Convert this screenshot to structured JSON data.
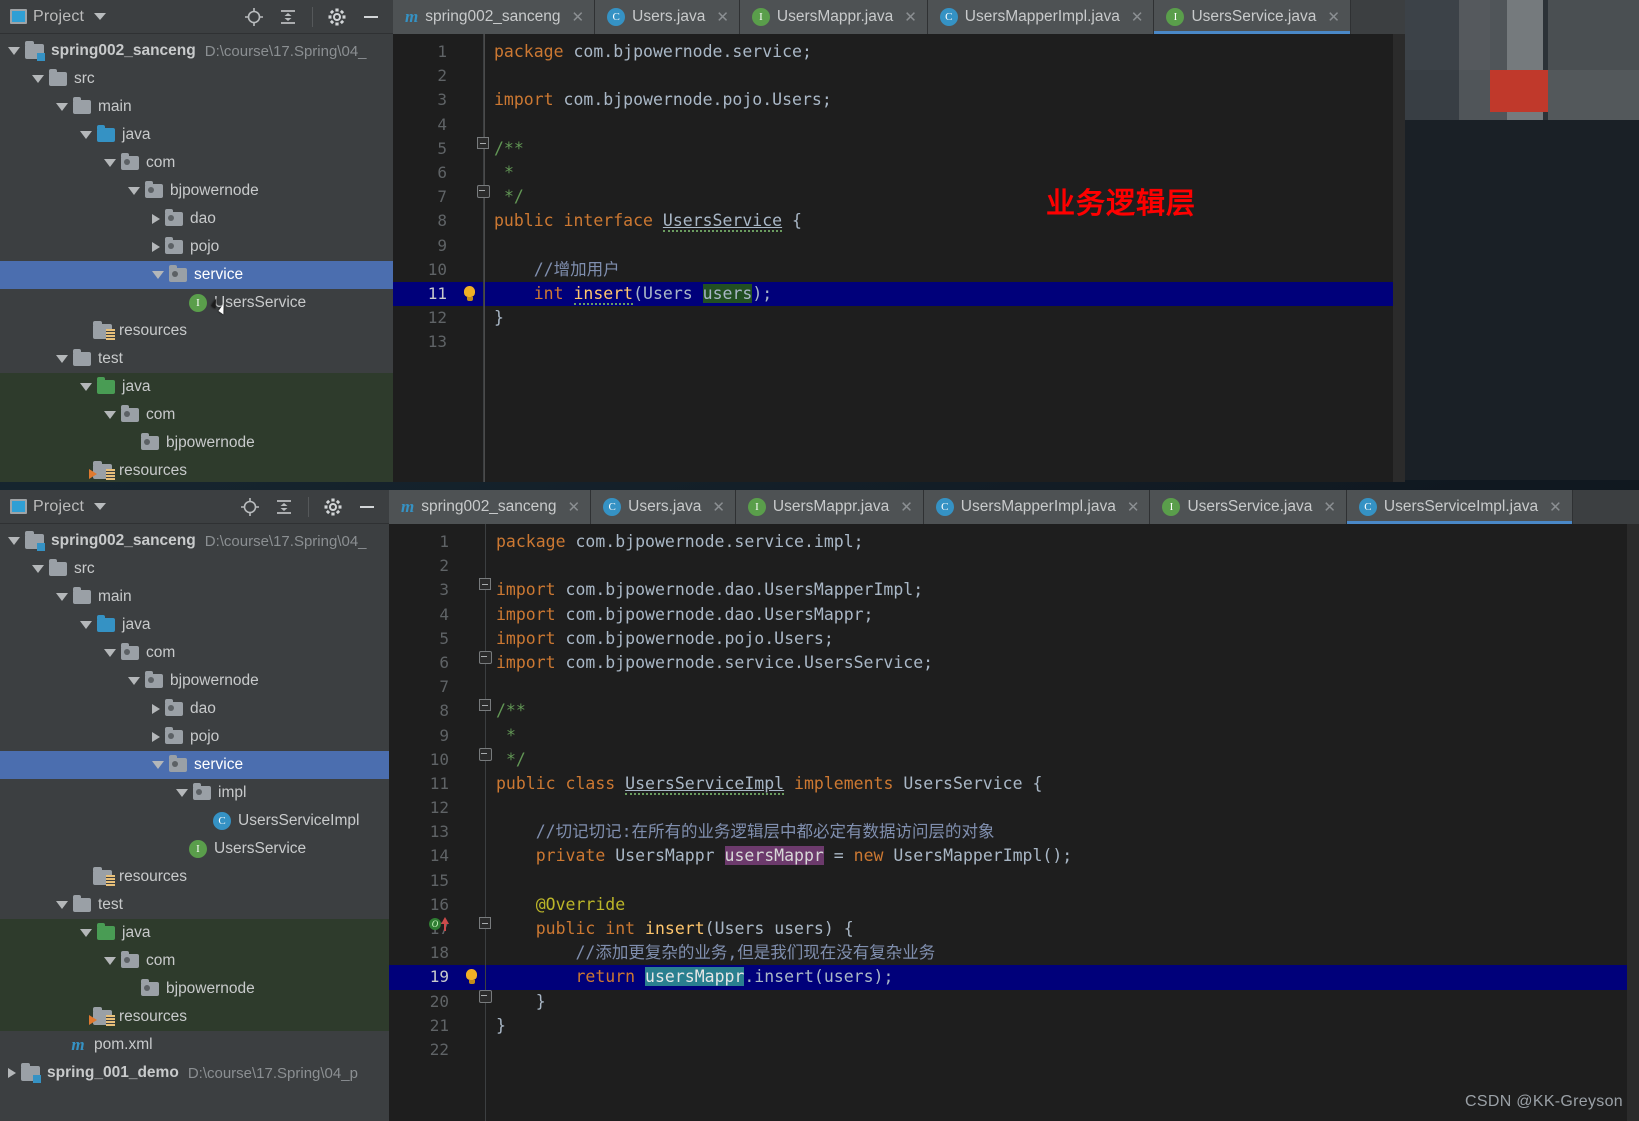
{
  "desktop": {
    "watermark": "CSDN @KK-Greyson"
  },
  "top_window": {
    "panel": {
      "title": "Project",
      "icons": [
        "locate-icon",
        "collapse-all-icon",
        "settings-gear-icon",
        "minimize-icon"
      ]
    },
    "tree": [
      {
        "label": "spring002_sanceng",
        "path": "D:\\course\\17.Spring\\04_",
        "icon": "module-icon",
        "arrow": "down",
        "depth": 0,
        "bold": true
      },
      {
        "label": "src",
        "icon": "folder-icon",
        "arrow": "down",
        "depth": 1
      },
      {
        "label": "main",
        "icon": "folder-icon",
        "arrow": "down",
        "depth": 2
      },
      {
        "label": "java",
        "icon": "folder-source-icon",
        "arrow": "down",
        "depth": 3
      },
      {
        "label": "com",
        "icon": "package-icon",
        "arrow": "down",
        "depth": 4
      },
      {
        "label": "bjpowernode",
        "icon": "package-icon",
        "arrow": "down",
        "depth": 5
      },
      {
        "label": "dao",
        "icon": "package-icon",
        "arrow": "right",
        "depth": 6
      },
      {
        "label": "pojo",
        "icon": "package-icon",
        "arrow": "right",
        "depth": 6
      },
      {
        "label": "service",
        "icon": "package-icon",
        "arrow": "down",
        "depth": 6,
        "selected": true
      },
      {
        "label": "UsersService",
        "icon": "interface-icon",
        "arrow": "none",
        "depth": 7
      },
      {
        "label": "resources",
        "icon": "resources-icon",
        "arrow": "none",
        "depth": 3
      },
      {
        "label": "test",
        "icon": "folder-icon",
        "arrow": "down",
        "depth": 2
      },
      {
        "label": "java",
        "icon": "folder-test-icon",
        "arrow": "down",
        "depth": 3,
        "test": true
      },
      {
        "label": "com",
        "icon": "package-icon",
        "arrow": "down",
        "depth": 4,
        "test": true
      },
      {
        "label": "bjpowernode",
        "icon": "package-icon",
        "arrow": "none",
        "depth": 5,
        "test": true
      },
      {
        "label": "resources",
        "icon": "resources-test-icon",
        "arrow": "none",
        "depth": 3,
        "test": true
      }
    ],
    "tabs": [
      {
        "label": "spring002_sanceng",
        "icon": "maven-icon",
        "active": false
      },
      {
        "label": "Users.java",
        "icon": "class-icon",
        "active": false
      },
      {
        "label": "UsersMappr.java",
        "icon": "interface-icon",
        "active": false
      },
      {
        "label": "UsersMapperImpl.java",
        "icon": "class-icon",
        "active": false
      },
      {
        "label": "UsersService.java",
        "icon": "interface-icon",
        "active": true
      }
    ],
    "annotation": "业务逻辑层",
    "code_lines": [
      {
        "n": 1,
        "html": "<span class=\"k\">package</span> com.bjpowernode.service;"
      },
      {
        "n": 2,
        "html": ""
      },
      {
        "n": 3,
        "html": "<span class=\"k\">import</span> com.bjpowernode.pojo.Users;"
      },
      {
        "n": 4,
        "html": ""
      },
      {
        "n": 5,
        "html": "<span class=\"cm\">/**</span>",
        "fold": "start"
      },
      {
        "n": 6,
        "html": " <span class=\"cm\">*</span>"
      },
      {
        "n": 7,
        "html": " <span class=\"cm\">*/</span>",
        "fold": "end"
      },
      {
        "n": 8,
        "html": "<span class=\"k\">public</span> <span class=\"k\">interface</span> <span class=\"decl wavy\">UsersService</span> {"
      },
      {
        "n": 9,
        "html": ""
      },
      {
        "n": 10,
        "html": "    <span class=\"cmz\">//增加用户</span>"
      },
      {
        "n": 11,
        "html": "    <span class=\"k\">int</span> <span class=\"fn wavy\">insert</span>(Users <span class=\"hl-green\">users</span>);",
        "hl": true,
        "bulb": true
      },
      {
        "n": 12,
        "html": "}"
      },
      {
        "n": 13,
        "html": ""
      }
    ]
  },
  "bottom_window": {
    "panel": {
      "title": "Project",
      "icons": [
        "locate-icon",
        "collapse-all-icon",
        "settings-gear-icon",
        "minimize-icon"
      ]
    },
    "tree": [
      {
        "label": "spring002_sanceng",
        "path": "D:\\course\\17.Spring\\04_",
        "icon": "module-icon",
        "arrow": "down",
        "depth": 0,
        "bold": true
      },
      {
        "label": "src",
        "icon": "folder-icon",
        "arrow": "down",
        "depth": 1
      },
      {
        "label": "main",
        "icon": "folder-icon",
        "arrow": "down",
        "depth": 2
      },
      {
        "label": "java",
        "icon": "folder-source-icon",
        "arrow": "down",
        "depth": 3
      },
      {
        "label": "com",
        "icon": "package-icon",
        "arrow": "down",
        "depth": 4
      },
      {
        "label": "bjpowernode",
        "icon": "package-icon",
        "arrow": "down",
        "depth": 5
      },
      {
        "label": "dao",
        "icon": "package-icon",
        "arrow": "right",
        "depth": 6
      },
      {
        "label": "pojo",
        "icon": "package-icon",
        "arrow": "right",
        "depth": 6
      },
      {
        "label": "service",
        "icon": "package-icon",
        "arrow": "down",
        "depth": 6,
        "selected": true
      },
      {
        "label": "impl",
        "icon": "package-icon",
        "arrow": "down",
        "depth": 7
      },
      {
        "label": "UsersServiceImpl",
        "icon": "class-icon",
        "arrow": "none",
        "depth": 8
      },
      {
        "label": "UsersService",
        "icon": "interface-icon",
        "arrow": "none",
        "depth": 7
      },
      {
        "label": "resources",
        "icon": "resources-icon",
        "arrow": "none",
        "depth": 3
      },
      {
        "label": "test",
        "icon": "folder-icon",
        "arrow": "down",
        "depth": 2
      },
      {
        "label": "java",
        "icon": "folder-test-icon",
        "arrow": "down",
        "depth": 3,
        "test": true
      },
      {
        "label": "com",
        "icon": "package-icon",
        "arrow": "down",
        "depth": 4,
        "test": true
      },
      {
        "label": "bjpowernode",
        "icon": "package-icon",
        "arrow": "none",
        "depth": 5,
        "test": true
      },
      {
        "label": "resources",
        "icon": "resources-test-icon",
        "arrow": "none",
        "depth": 3,
        "test": true
      },
      {
        "label": "pom.xml",
        "icon": "maven-icon",
        "arrow": "none",
        "depth": 2
      },
      {
        "label": "spring_001_demo",
        "path": "D:\\course\\17.Spring\\04_p",
        "icon": "module-icon",
        "arrow": "right",
        "depth": 0,
        "bold": true
      }
    ],
    "tabs": [
      {
        "label": "spring002_sanceng",
        "icon": "maven-icon",
        "active": false
      },
      {
        "label": "Users.java",
        "icon": "class-icon",
        "active": false
      },
      {
        "label": "UsersMappr.java",
        "icon": "interface-icon",
        "active": false
      },
      {
        "label": "UsersMapperImpl.java",
        "icon": "class-icon",
        "active": false
      },
      {
        "label": "UsersService.java",
        "icon": "interface-icon",
        "active": false
      },
      {
        "label": "UsersServiceImpl.java",
        "icon": "class-icon",
        "active": true
      }
    ],
    "code_lines": [
      {
        "n": 1,
        "html": "<span class=\"k\">package</span> com.bjpowernode.service.impl;"
      },
      {
        "n": 2,
        "html": ""
      },
      {
        "n": 3,
        "html": "<span class=\"k\">import</span> com.bjpowernode.dao.UsersMapperImpl;",
        "fold": "start"
      },
      {
        "n": 4,
        "html": "<span class=\"k\">import</span> com.bjpowernode.dao.UsersMappr;"
      },
      {
        "n": 5,
        "html": "<span class=\"k\">import</span> com.bjpowernode.pojo.Users;"
      },
      {
        "n": 6,
        "html": "<span class=\"k\">import</span> com.bjpowernode.service.UsersService;",
        "fold": "end"
      },
      {
        "n": 7,
        "html": ""
      },
      {
        "n": 8,
        "html": "<span class=\"cm\">/**</span>",
        "fold": "start"
      },
      {
        "n": 9,
        "html": " <span class=\"cm\">*</span>"
      },
      {
        "n": 10,
        "html": " <span class=\"cm\">*/</span>",
        "fold": "end"
      },
      {
        "n": 11,
        "html": "<span class=\"k\">public</span> <span class=\"k\">class</span> <span class=\"decl wavy\">UsersServiceImpl</span> <span class=\"k\">implements</span> UsersService {"
      },
      {
        "n": 12,
        "html": ""
      },
      {
        "n": 13,
        "html": "    <span class=\"cmz\">//切记切记:在所有的业务逻辑层中都必定有数据访问层的对象</span>"
      },
      {
        "n": 14,
        "html": "    <span class=\"k\">private</span> UsersMappr <span class=\"hl-purple\">usersMappr</span> = <span class=\"k\">new</span> UsersMapperImpl();"
      },
      {
        "n": 15,
        "html": ""
      },
      {
        "n": 16,
        "html": "    <span class=\"an\">@Override</span>"
      },
      {
        "n": 17,
        "html": "    <span class=\"k\">public</span> <span class=\"k\">int</span> <span class=\"fn\">insert</span>(Users users) {",
        "override": true,
        "fold": "start"
      },
      {
        "n": 18,
        "html": "        <span class=\"cmz\">//添加更复杂的业务,但是我们现在没有复杂业务</span>"
      },
      {
        "n": 19,
        "html": "        <span class=\"k\">return</span> <span class=\"hl-cyan\">usersMappr</span>.insert(users);",
        "hl": true,
        "bulb": true
      },
      {
        "n": 20,
        "html": "    }",
        "fold": "end"
      },
      {
        "n": 21,
        "html": "}"
      },
      {
        "n": 22,
        "html": ""
      }
    ]
  }
}
